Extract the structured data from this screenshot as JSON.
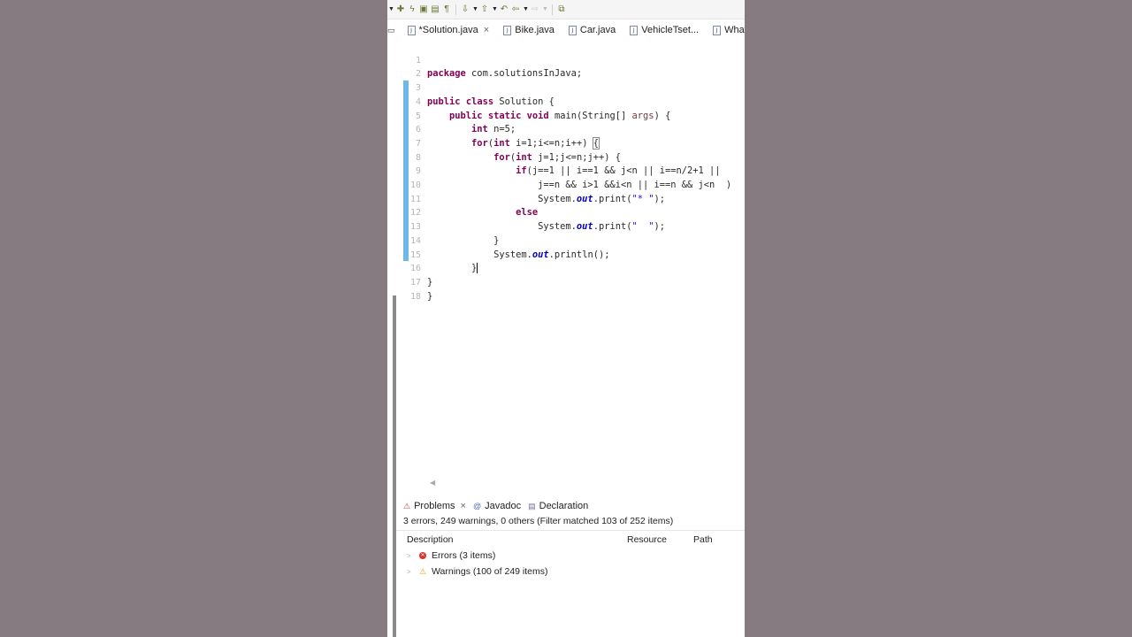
{
  "tabs": [
    {
      "label": "*Solution.java",
      "active": true,
      "closable": true
    },
    {
      "label": "Bike.java"
    },
    {
      "label": "Car.java"
    },
    {
      "label": "VehicleTset..."
    },
    {
      "label": "Whats.java"
    }
  ],
  "code": {
    "line_numbers": [
      "1",
      "2",
      "3",
      "4",
      "5",
      "6",
      "7",
      "8",
      "9",
      "10",
      "11",
      "12",
      "13",
      "14",
      "15",
      "16",
      "17",
      "18"
    ],
    "l1": {
      "kw": "package",
      "rest": " com.solutionsInJava;"
    },
    "l3": {
      "kw1": "public",
      "kw2": "class",
      "rest": " Solution {"
    },
    "l4": {
      "kw1": "public",
      "kw2": "static",
      "kw3": "void",
      "a": " main(String[] ",
      "var": "args",
      "b": ") {"
    },
    "l5": {
      "kw": "int",
      "rest": " n=5;"
    },
    "l6": {
      "kw1": "for",
      "a": "(",
      "kw2": "int",
      "b": " i=1;i<=n;i++) ",
      "brace": "{"
    },
    "l7": {
      "kw1": "for",
      "a": "(",
      "kw2": "int",
      "b": " j=1;j<=n;j++) {"
    },
    "l8": {
      "kw": "if",
      "rest": "(j==1 || i==1 && j<n || i==n/2+1 ||"
    },
    "l9": {
      "rest": "j==n && i>1 &&i<n || i==n && j<n  )"
    },
    "l10": {
      "a": "System.",
      "fld": "out",
      "b": ".print(",
      "str": "\"* \"",
      "c": ");"
    },
    "l11": {
      "kw": "else"
    },
    "l12": {
      "a": "System.",
      "fld": "out",
      "b": ".print(",
      "str": "\"  \"",
      "c": ");"
    },
    "l13": {
      "rest": "}"
    },
    "l14": {
      "a": "System.",
      "fld": "out",
      "b": ".println();"
    },
    "l15": {
      "rest": "}"
    },
    "l16": {
      "rest": "}"
    },
    "l17": {
      "rest": "}"
    }
  },
  "problems": {
    "tabs": [
      "Problems",
      "Javadoc",
      "Declaration"
    ],
    "summary": "3 errors, 249 warnings, 0 others (Filter matched 103 of 252 items)",
    "columns": [
      "Description",
      "Resource",
      "Path"
    ],
    "rows": [
      "Errors (3 items)",
      "Warnings (100 of 249 items)"
    ]
  }
}
